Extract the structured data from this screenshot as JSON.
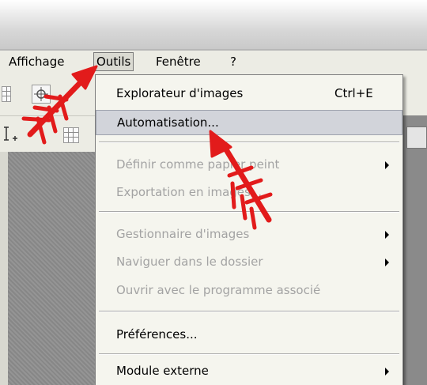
{
  "menubar": {
    "items": [
      {
        "label": "Affichage"
      },
      {
        "label": "Outils"
      },
      {
        "label": "Fenêtre"
      },
      {
        "label": "?"
      }
    ]
  },
  "dropdown": {
    "items": [
      {
        "label": "Explorateur d'images",
        "shortcut": "Ctrl+E",
        "enabled": true
      },
      {
        "label": "Automatisation...",
        "enabled": true,
        "highlighted": true
      },
      {
        "label": "Définir comme papier peint",
        "enabled": false,
        "submenu": true
      },
      {
        "label": "Exportation en images...",
        "enabled": false
      },
      {
        "label": "Gestionnaire d'images",
        "enabled": false,
        "submenu": true
      },
      {
        "label": "Naviguer dans le dossier",
        "enabled": false,
        "submenu": true
      },
      {
        "label": "Ouvrir avec le programme associé",
        "enabled": false
      },
      {
        "label": "Préférences...",
        "enabled": true
      },
      {
        "label": "Module externe",
        "enabled": true,
        "submenu": true
      }
    ]
  },
  "annotations": {
    "arrow_color": "#e21b1b"
  }
}
